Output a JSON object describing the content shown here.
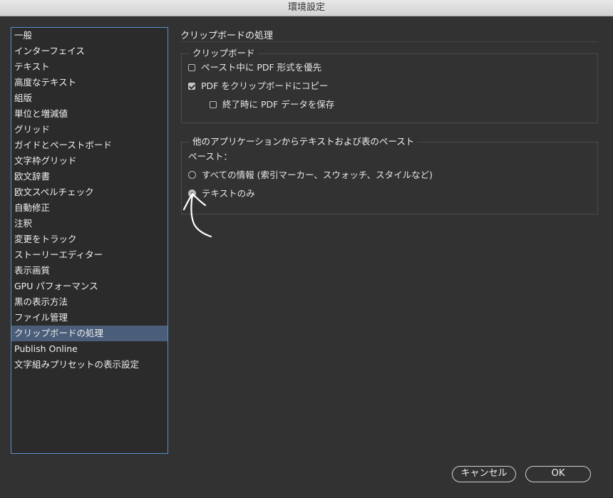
{
  "window": {
    "title": "環境設定"
  },
  "sidebar": {
    "items": [
      "一般",
      "インターフェイス",
      "テキスト",
      "高度なテキスト",
      "組版",
      "単位と増減値",
      "グリッド",
      "ガイドとペーストボード",
      "文字枠グリッド",
      "欧文辞書",
      "欧文スペルチェック",
      "自動修正",
      "注釈",
      "変更をトラック",
      "ストーリーエディター",
      "表示画質",
      "GPU パフォーマンス",
      "黒の表示方法",
      "ファイル管理",
      "クリップボードの処理",
      "Publish Online",
      "文字組みプリセットの表示設定"
    ],
    "selected_index": 19
  },
  "main": {
    "section_title": "クリップボードの処理",
    "clipboard_group": {
      "label": "クリップボード",
      "prefer_pdf_label": "ペースト中に PDF 形式を優先",
      "prefer_pdf_checked": false,
      "copy_pdf_label": "PDF をクリップボードにコピー",
      "copy_pdf_checked": true,
      "preserve_pdf_label": "終了時に PDF データを保存",
      "preserve_pdf_checked": false
    },
    "paste_group": {
      "label": "他のアプリケーションからテキストおよび表のペースト",
      "paste_label": "ペースト：",
      "all_info_label": "すべての情報 (索引マーカー、スウォッチ、スタイルなど)",
      "text_only_label": "テキストのみ",
      "selected": "text_only"
    }
  },
  "buttons": {
    "cancel": "キャンセル",
    "ok": "OK"
  }
}
